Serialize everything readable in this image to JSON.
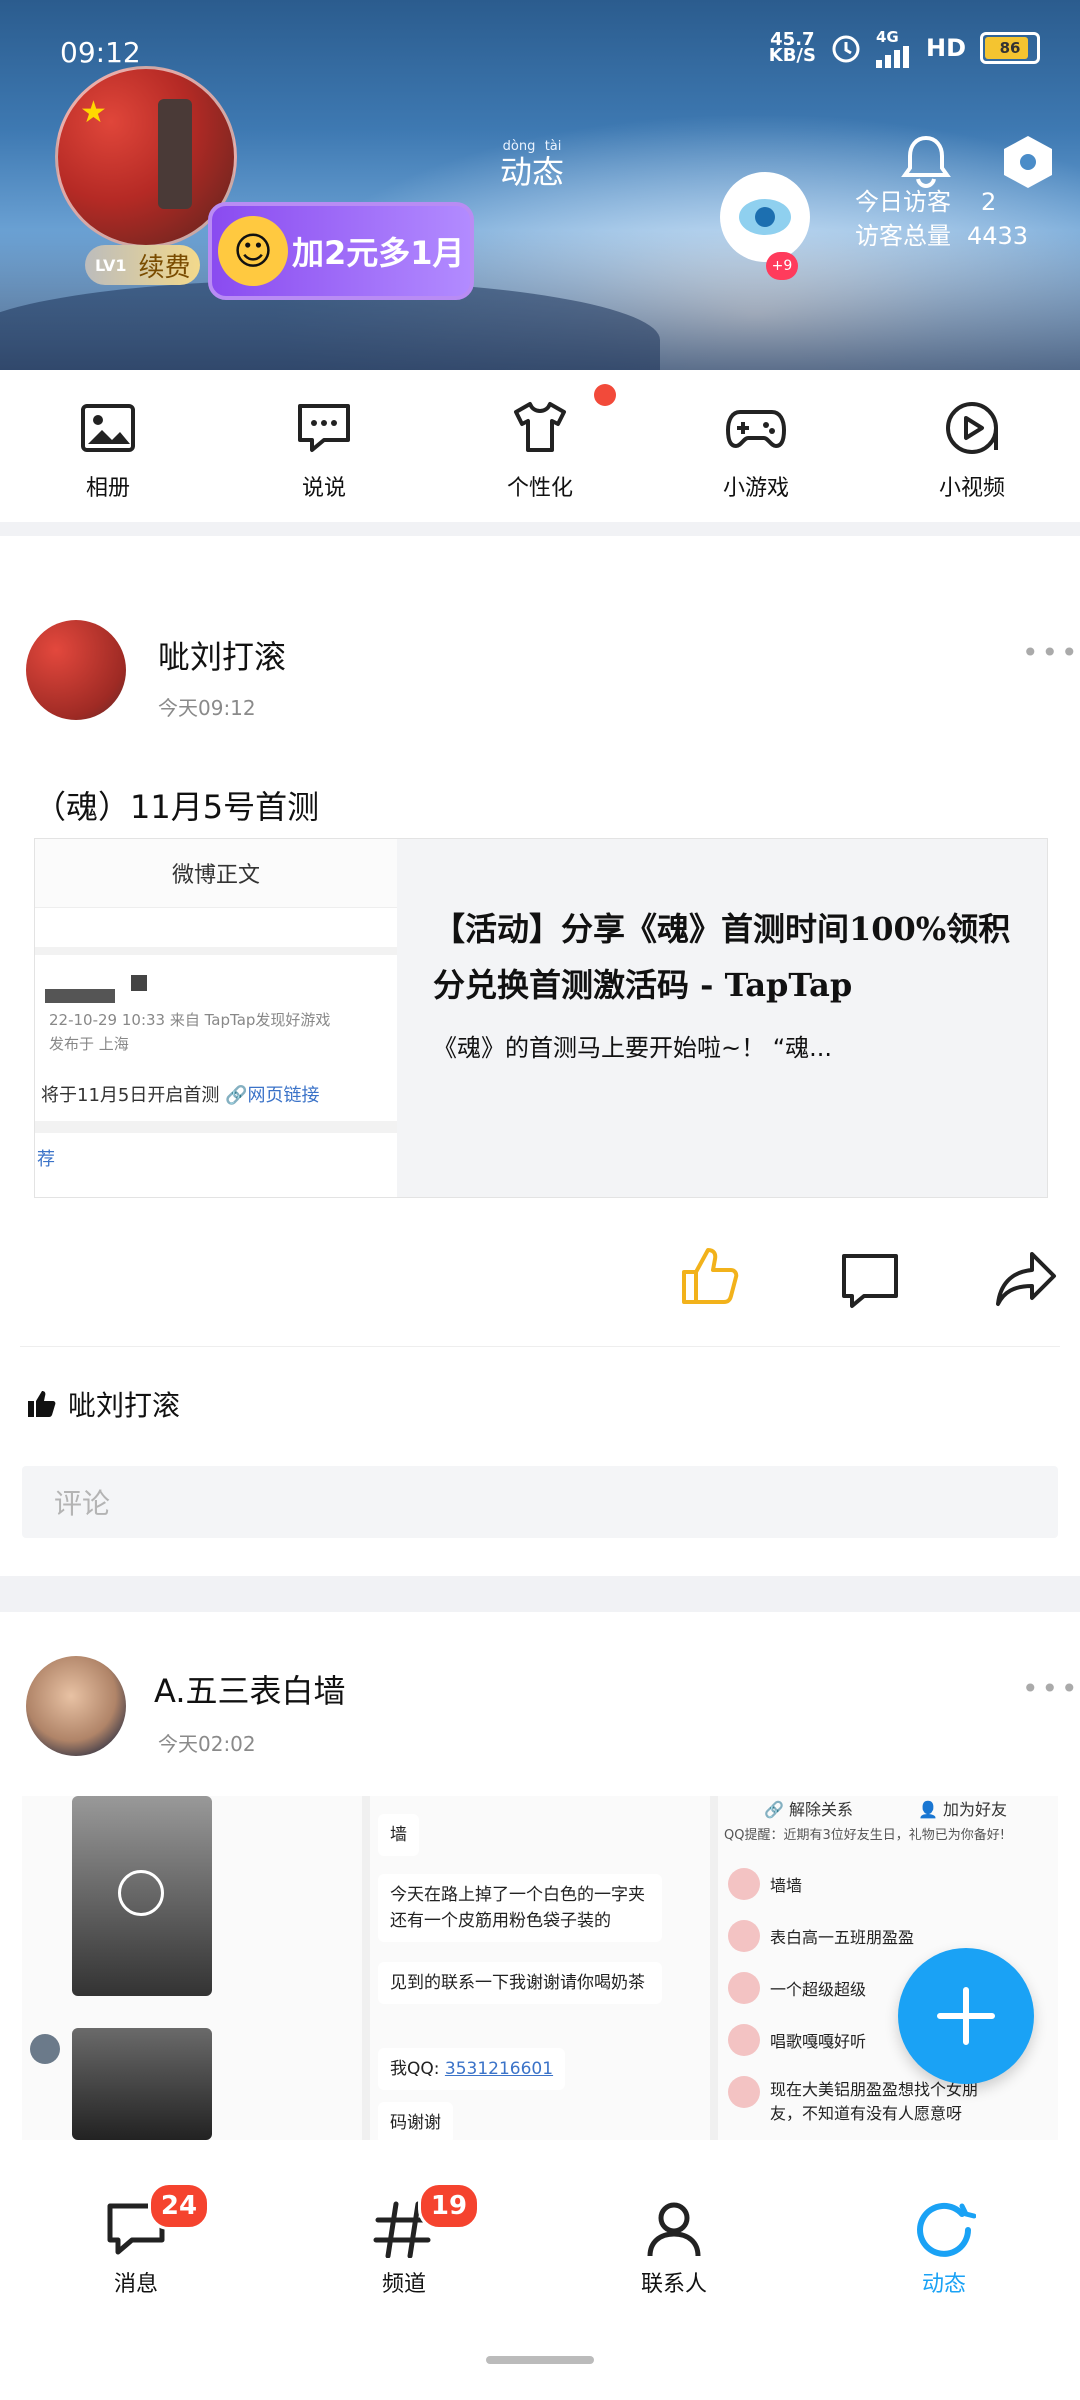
{
  "status_bar": {
    "time": "09:12",
    "speed": "45.7",
    "speed_unit": "KB/S",
    "network": "4G",
    "hd": "HD",
    "battery": "86"
  },
  "header": {
    "level": "LV1",
    "renew_label": "续费",
    "promo_text": "加2元多1月",
    "title": "动态",
    "title_pinyin": "dòng tài",
    "visitor_badge": "+9",
    "today_visitors_label": "今日访客",
    "today_visitors_value": "2",
    "total_visitors_label": "访客总量",
    "total_visitors_value": "4433"
  },
  "quick_nav": {
    "items": [
      {
        "label": "相册",
        "icon": "photo-album-icon"
      },
      {
        "label": "说说",
        "icon": "chat-bubble-icon"
      },
      {
        "label": "个性化",
        "icon": "tshirt-icon"
      },
      {
        "label": "小游戏",
        "icon": "gamepad-icon"
      },
      {
        "label": "小视频",
        "icon": "video-play-icon"
      }
    ]
  },
  "posts": [
    {
      "author": "呲刘打滚",
      "time": "今天09:12",
      "text": "（魂）11月5号首测",
      "link_card": {
        "thumb_header": "微博正文",
        "thumb_meta_1": "22-10-29 10:33  来自 TapTap发现好游戏",
        "thumb_meta_2": "发布于 上海",
        "thumb_body": "将于11月5日开启首测",
        "thumb_link": "网页链接",
        "thumb_more": "荐",
        "title": "【活动】分享《魂》首测时间100%领积分兑换首测激活码 - TapTap",
        "description": "《魂》的首测马上要开始啦~！ “魂..."
      },
      "liked_by": "呲刘打滚",
      "comment_placeholder": "评论"
    },
    {
      "author": "A.五三表白墙",
      "time": "今天02:02",
      "screens": {
        "middle": [
          "墙",
          "今天在路上掉了一个白色的一字夹还有一个皮筋用粉色袋子装的",
          "见到的联系一下我谢谢请你喝奶茶",
          "我QQ: ",
          "3531216601",
          "码谢谢"
        ],
        "right_header_1": "解除关系",
        "right_header_2": "加为好友",
        "right_notice": "QQ提醒：近期有3位好友生日，礼物已为你备好!",
        "right_items": [
          "墙墙",
          "表白高一五班朋盈盈",
          "一个超级超级",
          "唱歌嘎嘎好听",
          "现在大美铝朋盈盈想找个女朋友，不知道有没有人愿意呀"
        ]
      }
    }
  ],
  "bottom_nav": {
    "items": [
      {
        "label": "消息",
        "badge": "24"
      },
      {
        "label": "频道",
        "badge": "19"
      },
      {
        "label": "联系人",
        "badge": ""
      },
      {
        "label": "动态",
        "badge": ""
      }
    ],
    "active_color": "#1aa2f5"
  },
  "colors": {
    "accent": "#1aa2f5",
    "badge": "#f5432e",
    "like": "#f2b21b"
  }
}
